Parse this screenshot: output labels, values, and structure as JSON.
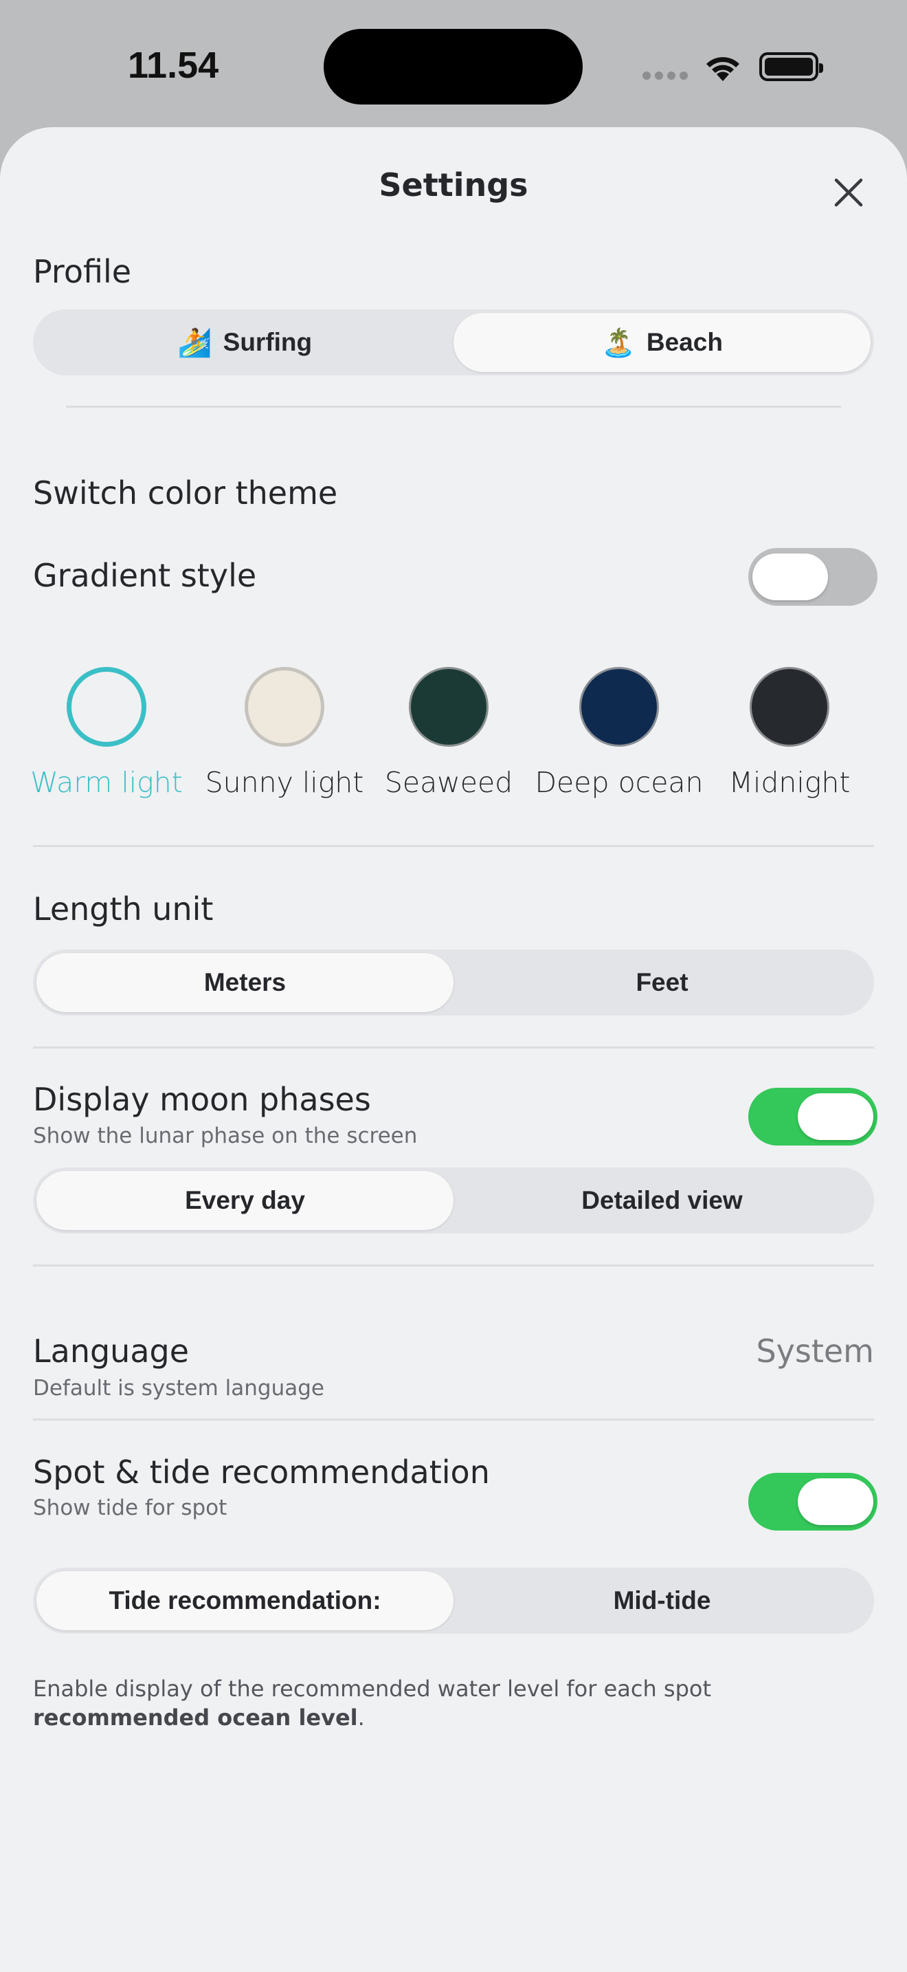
{
  "status": {
    "time": "11.54"
  },
  "sheet": {
    "title": "Settings"
  },
  "profile": {
    "label": "Profile",
    "options": [
      {
        "emoji": "🏄",
        "label": "Surfing"
      },
      {
        "emoji": "🏝️",
        "label": "Beach"
      }
    ],
    "selected": "Beach"
  },
  "theme": {
    "label": "Switch color theme",
    "gradient_label": "Gradient style",
    "gradient_enabled": false,
    "swatches": [
      {
        "name": "Warm light",
        "color": "#f0f1f3",
        "ring": "#3bbfc6",
        "selected": true
      },
      {
        "name": "Sunny light",
        "color": "#efe9dd",
        "ring": "#c6c3bd",
        "selected": false
      },
      {
        "name": "Seaweed",
        "color": "#1b3a36",
        "ring": "#8a8f8e",
        "selected": false
      },
      {
        "name": "Deep ocean",
        "color": "#0f2a4f",
        "ring": "#8a8f94",
        "selected": false
      },
      {
        "name": "Midnight",
        "color": "#26292e",
        "ring": "#8a8b8e",
        "selected": false
      }
    ]
  },
  "length_unit": {
    "label": "Length unit",
    "options": [
      "Meters",
      "Feet"
    ],
    "selected": "Meters"
  },
  "moon": {
    "label": "Display moon phases",
    "sublabel": "Show the lunar phase on the screen",
    "enabled": true,
    "options": [
      "Every day",
      "Detailed view"
    ],
    "selected": "Every day"
  },
  "language": {
    "label": "Language",
    "sublabel": "Default is system language",
    "value": "System"
  },
  "tide": {
    "label": "Spot & tide recommendation",
    "sublabel": "Show tide for spot",
    "enabled": true,
    "options": [
      "Tide recommendation:",
      "Mid-tide"
    ],
    "selected": "Tide recommendation:",
    "footnote_text": "Enable display of the recommended water level for each spot ",
    "footnote_bold": "recommended ocean level",
    "footnote_end": "."
  },
  "colors": {
    "accent": "#3bbfc6",
    "toggle_on": "#34c759",
    "toggle_off": "#bcbdbf",
    "sheet_bg": "#f0f1f3"
  }
}
